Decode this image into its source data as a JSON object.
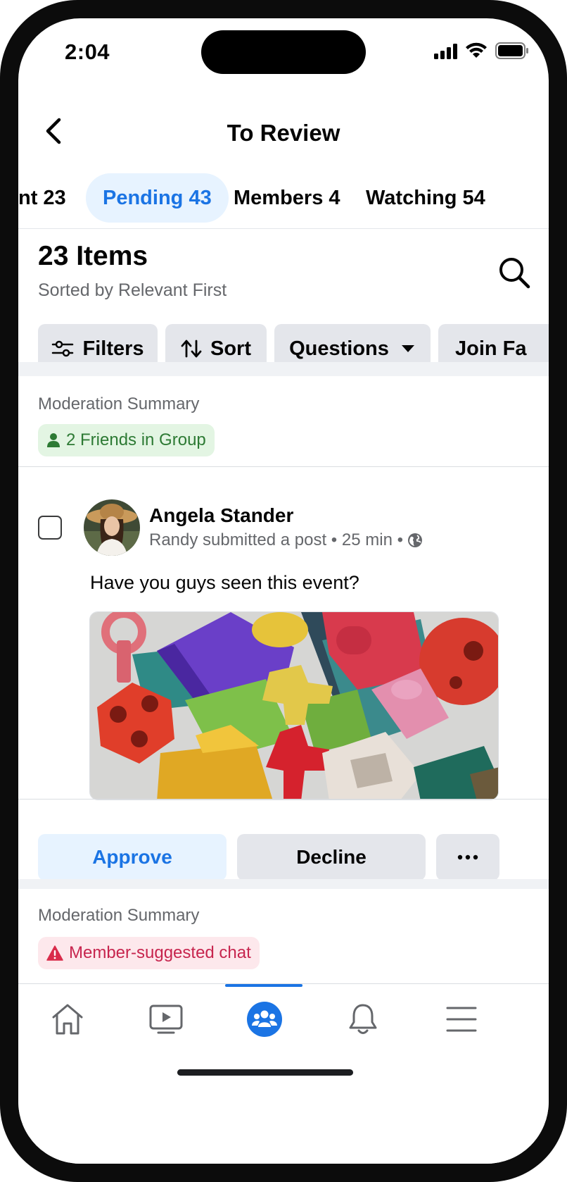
{
  "status_bar": {
    "time": "2:04"
  },
  "header": {
    "title": "To Review"
  },
  "tabs": [
    {
      "label": "nt  23"
    },
    {
      "label": "Pending 43",
      "active": true
    },
    {
      "label": "Members 4"
    },
    {
      "label": "Watching 54"
    }
  ],
  "list_header": {
    "title": "23 Items",
    "subtitle": "Sorted by Relevant First"
  },
  "filters": {
    "filters_label": "Filters",
    "sort_label": "Sort",
    "questions_label": "Questions",
    "join_label": "Join Fa"
  },
  "card1": {
    "moderation_label": "Moderation Summary",
    "badge": "2 Friends in Group",
    "author": "Angela Stander",
    "meta": "Randy submitted a post • 25 min •",
    "text": "Have you guys seen this event?",
    "approve_label": "Approve",
    "decline_label": "Decline",
    "more_label": "···"
  },
  "card2": {
    "moderation_label": "Moderation Summary",
    "badge": "Member-suggested chat"
  },
  "colors": {
    "accent": "#1b74e4",
    "accent_bg": "#e7f3ff",
    "chip_bg": "#e4e6eb",
    "green_badge_bg": "#e3f5e3",
    "green_text": "#2d7a34",
    "red_badge_bg": "#fde8ec",
    "red_text": "#c7254e"
  },
  "nav": {
    "items": [
      {
        "icon": "home-icon"
      },
      {
        "icon": "video-icon"
      },
      {
        "icon": "groups-icon",
        "active": true
      },
      {
        "icon": "bell-icon"
      },
      {
        "icon": "menu-icon"
      }
    ]
  }
}
